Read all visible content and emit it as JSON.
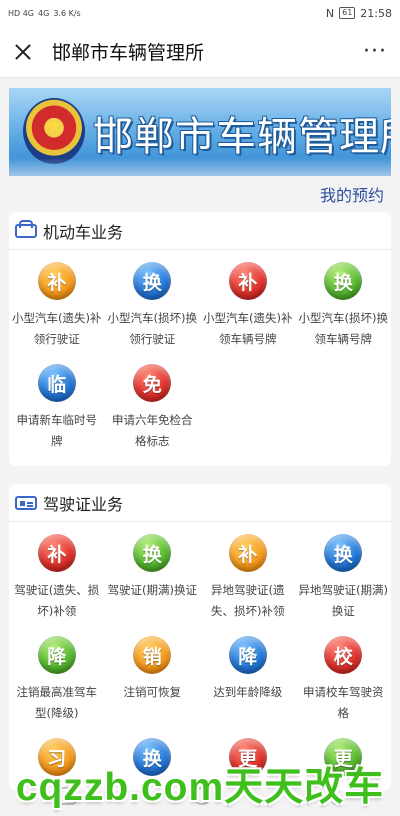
{
  "status_bar": {
    "left_signal_1": "HD 4G",
    "left_signal_2": "4G",
    "speed": "3.6 K/s",
    "nfc": "N",
    "battery": "61",
    "time": "21:58"
  },
  "header": {
    "title": "邯郸市车辆管理所",
    "more_label": "···"
  },
  "banner": {
    "title": "邯郸市车辆管理所"
  },
  "appointment_label": "我的预约",
  "sections": [
    {
      "title": "机动车业务",
      "items": [
        {
          "glyph": "补",
          "color": "orange",
          "label": "小型汽车(遗失)补领行驶证"
        },
        {
          "glyph": "换",
          "color": "blue",
          "label": "小型汽车(损坏)换领行驶证"
        },
        {
          "glyph": "补",
          "color": "red",
          "label": "小型汽车(遗失)补领车辆号牌"
        },
        {
          "glyph": "换",
          "color": "green",
          "label": "小型汽车(损坏)换领车辆号牌"
        },
        {
          "glyph": "临",
          "color": "blue",
          "label": "申请新车临时号牌"
        },
        {
          "glyph": "免",
          "color": "red",
          "label": "申请六年免检合格标志"
        }
      ]
    },
    {
      "title": "驾驶证业务",
      "items": [
        {
          "glyph": "补",
          "color": "red",
          "label": "驾驶证(遗失、损坏)补领"
        },
        {
          "glyph": "换",
          "color": "green",
          "label": "驾驶证(期满)换证"
        },
        {
          "glyph": "补",
          "color": "orange",
          "label": "异地驾驶证(遗失、损坏)补领"
        },
        {
          "glyph": "换",
          "color": "blue",
          "label": "异地驾驶证(期满)换证"
        },
        {
          "glyph": "降",
          "color": "green",
          "label": "注销最高准驾车型(降级)"
        },
        {
          "glyph": "销",
          "color": "orange",
          "label": "注销可恢复"
        },
        {
          "glyph": "降",
          "color": "blue",
          "label": "达到年龄降级"
        },
        {
          "glyph": "校",
          "color": "red",
          "label": "申请校车驾驶资格"
        },
        {
          "glyph": "习",
          "color": "orange",
          "label": ""
        },
        {
          "glyph": "换",
          "color": "blue",
          "label": ""
        },
        {
          "glyph": "更",
          "color": "red",
          "label": ""
        },
        {
          "glyph": "更",
          "color": "green",
          "label": ""
        }
      ]
    }
  ],
  "watermark": "cqzzb.com天天改车",
  "icons": {
    "close": "close-icon",
    "more": "more-icon",
    "car": "car-icon",
    "license": "license-card-icon",
    "emblem": "police-emblem-icon"
  }
}
